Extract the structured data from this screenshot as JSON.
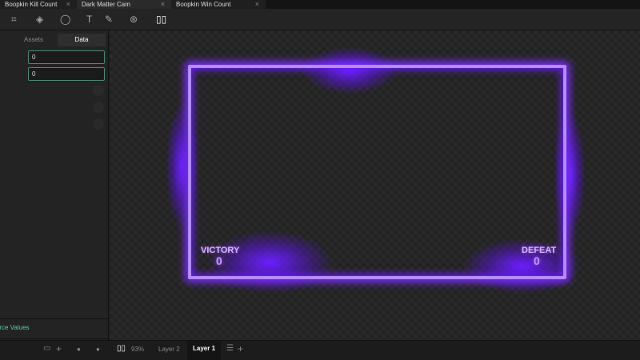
{
  "tabs": [
    {
      "label": "Boopkin Kill Count"
    },
    {
      "label": "Dark Matter Cam"
    },
    {
      "label": "Boopkin Win Count"
    }
  ],
  "panel": {
    "tabs": [
      "Assets",
      "Data"
    ],
    "fields": [
      "0",
      "0"
    ],
    "force_values": "Force Values"
  },
  "overlay": {
    "victory_label": "VICTORY",
    "victory_count": "0",
    "defeat_label": "DEFEAT",
    "defeat_count": "0"
  },
  "bottom": {
    "zoom": "93%",
    "layers": [
      "Layer 2",
      "Layer 1"
    ]
  },
  "colors": {
    "accent": "#5fcf9f",
    "glow": "#7a2cff"
  }
}
